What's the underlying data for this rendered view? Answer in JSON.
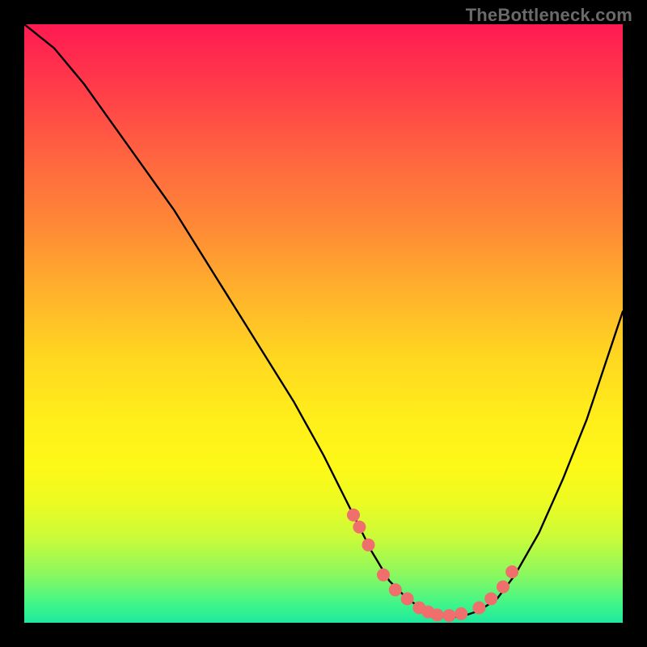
{
  "watermark": "TheBottleneck.com",
  "chart_data": {
    "type": "line",
    "title": "",
    "xlabel": "",
    "ylabel": "",
    "xlim": [
      0,
      100
    ],
    "ylim": [
      0,
      100
    ],
    "series": [
      {
        "name": "bottleneck-curve",
        "x": [
          0,
          5,
          10,
          15,
          20,
          25,
          30,
          35,
          40,
          45,
          50,
          55,
          58,
          61,
          64,
          67,
          70,
          73,
          76,
          79,
          82,
          86,
          90,
          94,
          100
        ],
        "y": [
          100,
          96,
          90,
          83,
          76,
          69,
          61,
          53,
          45,
          37,
          28,
          18,
          12,
          7,
          4,
          2,
          1,
          1,
          2,
          4,
          8,
          15,
          24,
          34,
          52
        ]
      }
    ],
    "points": {
      "name": "highlight-points",
      "x": [
        55,
        56,
        57.5,
        60,
        62,
        64,
        66,
        67.5,
        69,
        71,
        73,
        76,
        78,
        80,
        81.5
      ],
      "y": [
        18,
        16,
        13,
        8,
        5.5,
        4,
        2.5,
        1.8,
        1.3,
        1.2,
        1.5,
        2.5,
        4,
        6,
        8.5
      ]
    },
    "background_gradient": {
      "top_color": "#ff1a52",
      "mid_color": "#ffee1a",
      "bottom_color": "#1ee99e"
    }
  }
}
